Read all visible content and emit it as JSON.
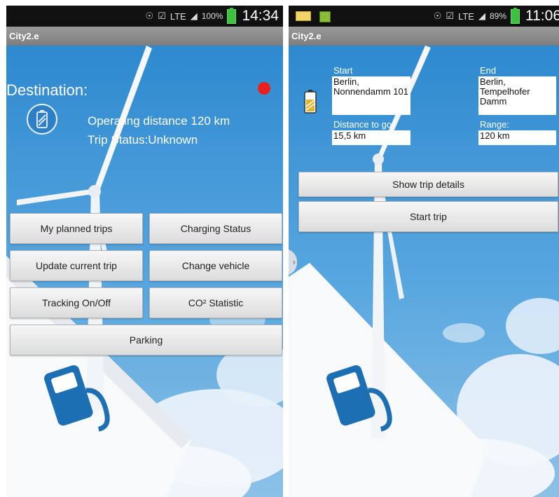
{
  "left": {
    "status": {
      "battery_pct": "100%",
      "time": "14:34",
      "network": "LTE"
    },
    "app_title": "City2.e",
    "destination_label": "Destination:",
    "operating_distance": "Operating distance 120 km",
    "trip_status": "Trip Status:Unknown",
    "status_dot_color": "#e8201e",
    "buttons": {
      "planned_trips": "My planned trips",
      "charging_status": "Charging Status",
      "update_trip": "Update current trip",
      "change_vehicle": "Change vehicle",
      "tracking": "Tracking On/Off",
      "co2": "CO² Statistic",
      "parking": "Parking"
    }
  },
  "right": {
    "status": {
      "battery_pct": "89%",
      "time": "11:06",
      "network": "LTE"
    },
    "app_title": "City2.e",
    "start_label": "Start",
    "start_value": "Berlin, Nonnendamm 101",
    "end_label": "End",
    "end_value": "Berlin, Tempelhofer Damm",
    "distance_label": "Distance to go",
    "distance_value": "15,5 km",
    "range_label": "Range:",
    "range_value": "120 km",
    "buttons": {
      "show_details": "Show trip details",
      "start_trip": "Start trip"
    }
  },
  "icons": [
    "battery-icon",
    "fuel-pump-icon",
    "wind-turbine",
    "chevron-right-icon",
    "alarm-icon",
    "mute-icon",
    "signal-icon"
  ]
}
